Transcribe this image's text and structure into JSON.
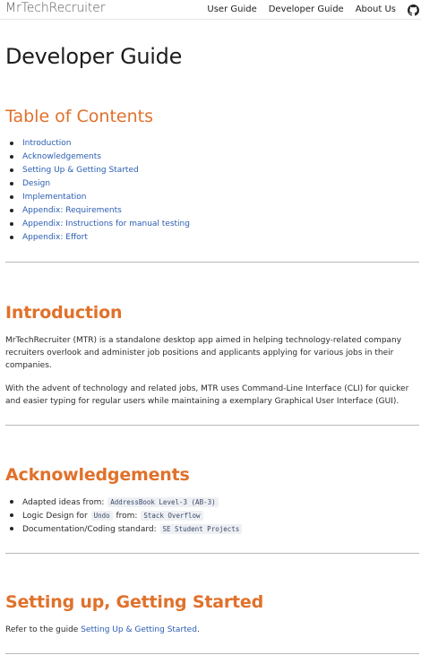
{
  "header": {
    "brand": "MrTechRecruiter",
    "nav": [
      "User Guide",
      "Developer Guide",
      "About Us"
    ],
    "github_icon": "github-icon"
  },
  "page_title": "Developer Guide",
  "toc": {
    "title": "Table of Contents",
    "items": [
      "Introduction",
      "Acknowledgements",
      "Setting Up & Getting Started",
      "Design",
      "Implementation",
      "Appendix: Requirements",
      "Appendix: Instructions for manual testing",
      "Appendix: Effort"
    ],
    "link_color": "#2a5db0",
    "heading_color": "#e0712b"
  },
  "introduction": {
    "title": "Introduction",
    "p1": "MrTechRecruiter (MTR) is a standalone desktop app aimed in helping technology-related company recruiters overlook and administer job positions and applicants applying for various jobs in their companies.",
    "p2": "With the advent of technology and related jobs, MTR uses Command-Line Interface (CLI) for quicker and easier typing for regular users while maintaining a exemplary Graphical User Interface (GUI)."
  },
  "acknowledgements": {
    "title": "Acknowledgements",
    "items": [
      {
        "prefix": "Adapted ideas from: ",
        "code1": "AddressBook Level-3 (AB-3)"
      },
      {
        "prefix": "Logic Design for ",
        "code1": "Undo",
        "mid": " from: ",
        "code2": "Stack Overflow"
      },
      {
        "prefix": "Documentation/Coding standard: ",
        "code1": "SE Student Projects"
      }
    ]
  },
  "setup": {
    "title": "Setting up, Getting Started",
    "text_before": "Refer to the guide ",
    "link": "Setting Up & Getting Started",
    "text_after": "."
  }
}
